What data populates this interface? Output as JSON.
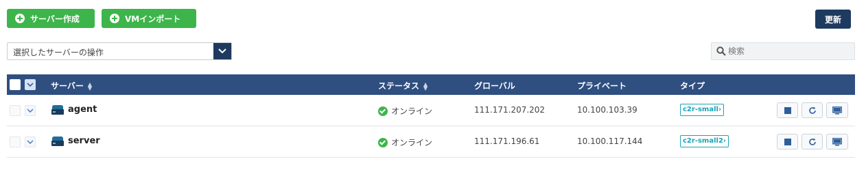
{
  "toolbar": {
    "create_label": "サーバー作成",
    "import_label": "VMインポート",
    "refresh_label": "更新"
  },
  "action_select": {
    "value": "選択したサーバーの操作"
  },
  "search": {
    "placeholder": "検索"
  },
  "table": {
    "headers": {
      "server": "サーバー",
      "status": "ステータス",
      "global": "グローバル",
      "private": "プライベート",
      "type": "タイプ"
    },
    "rows": [
      {
        "name": "agent",
        "status": "オンライン",
        "global_ip": "111.171.207.202",
        "private_ip": "10.100.103.39",
        "type": "c2r-small"
      },
      {
        "name": "server",
        "status": "オンライン",
        "global_ip": "111.171.196.61",
        "private_ip": "10.100.117.144",
        "type": "c2r-small2"
      }
    ]
  },
  "colors": {
    "green": "#3db54a",
    "navy": "#1e3a5f",
    "header_blue": "#2f4f80",
    "teal": "#19a2b6"
  },
  "icons": {
    "create": "plus-circle-icon",
    "import": "plus-circle-icon",
    "caret": "chevron-down-icon",
    "search": "search-icon",
    "sort": "sort-icon",
    "server": "server-icon",
    "online": "check-circle-icon",
    "type_arrow": "chevron-right-icon",
    "stop": "stop-icon",
    "restart": "refresh-icon",
    "console": "monitor-icon"
  }
}
